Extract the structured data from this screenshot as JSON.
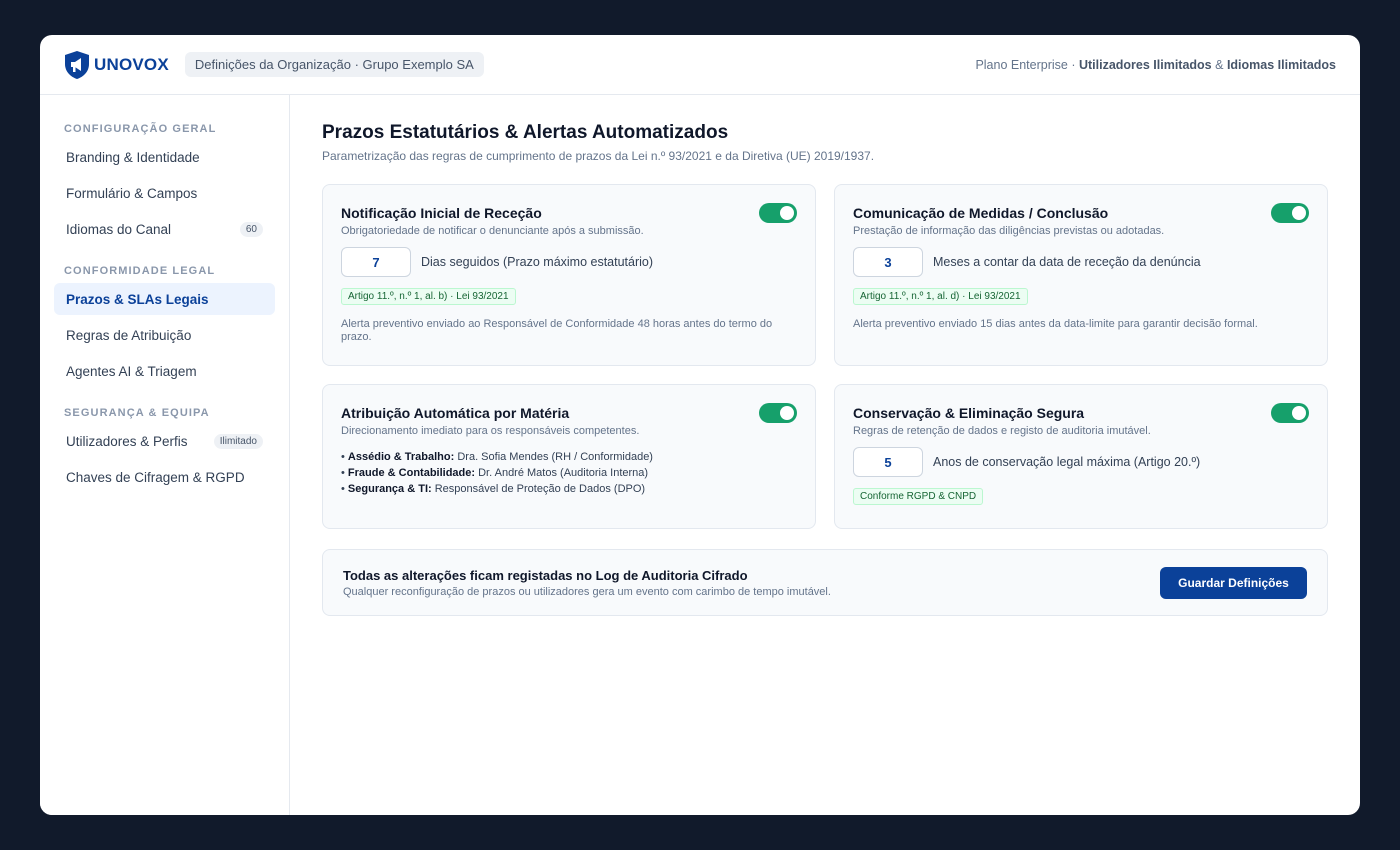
{
  "header": {
    "brand": "UNOVOX",
    "org_context": "Definições da Organização · Grupo Exemplo SA",
    "plan_prefix": "Plano Enterprise · ",
    "plan_users": "Utilizadores Ilimitados",
    "plan_joiner": " & ",
    "plan_languages": "Idiomas Ilimitados"
  },
  "sidebar": {
    "sections": [
      {
        "heading": "CONFIGURAÇÃO GERAL",
        "items": [
          {
            "label": "Branding & Identidade"
          },
          {
            "label": "Formulário & Campos"
          },
          {
            "label": "Idiomas do Canal",
            "badge": "60"
          }
        ]
      },
      {
        "heading": "CONFORMIDADE LEGAL",
        "items": [
          {
            "label": "Prazos & SLAs Legais",
            "active": true
          },
          {
            "label": "Regras de Atribuição"
          },
          {
            "label": "Agentes AI & Triagem"
          }
        ]
      },
      {
        "heading": "SEGURANÇA & EQUIPA",
        "items": [
          {
            "label": "Utilizadores & Perfis",
            "badge": "Ilimitado"
          },
          {
            "label": "Chaves de Cifragem & RGPD"
          }
        ]
      }
    ]
  },
  "main": {
    "title": "Prazos Estatutários & Alertas Automatizados",
    "subtitle": "Parametrização das regras de cumprimento de prazos da Lei n.º 93/2021 e da Diretiva (UE) 2019/1937.",
    "cards": {
      "reception": {
        "title": "Notificação Inicial de Receção",
        "desc": "Obrigatoriedade de notificar o denunciante após a submissão.",
        "enabled": true,
        "value": "7",
        "value_label": "Dias seguidos (Prazo máximo estatutário)",
        "law": "Artigo 11.º, n.º 1, al. b) · Lei 93/2021",
        "note": "Alerta preventivo enviado ao Responsável de Conformidade 48 horas antes do termo do prazo."
      },
      "conclusion": {
        "title": "Comunicação de Medidas / Conclusão",
        "desc": "Prestação de informação das diligências previstas ou adotadas.",
        "enabled": true,
        "value": "3",
        "value_label": "Meses a contar da data de receção da denúncia",
        "law": "Artigo 11.º, n.º 1, al. d) · Lei 93/2021",
        "note": "Alerta preventivo enviado 15 dias antes da data-limite para garantir decisão formal."
      },
      "assignment": {
        "title": "Atribuição Automática por Matéria",
        "desc": "Direcionamento imediato para os responsáveis competentes.",
        "enabled": true,
        "rules": [
          {
            "topic": "Assédio & Trabalho:",
            "owner": "Dra. Sofia Mendes (RH / Conformidade)"
          },
          {
            "topic": "Fraude & Contabilidade:",
            "owner": "Dr. André Matos (Auditoria Interna)"
          },
          {
            "topic": "Segurança & TI:",
            "owner": "Responsável de Proteção de Dados (DPO)"
          }
        ]
      },
      "retention": {
        "title": "Conservação & Eliminação Segura",
        "desc": "Regras de retenção de dados e registo de auditoria imutável.",
        "enabled": true,
        "value": "5",
        "value_label": "Anos de conservação legal máxima (Artigo 20.º)",
        "law": "Conforme RGPD & CNPD"
      }
    },
    "footer": {
      "title": "Todas as alterações ficam registadas no Log de Auditoria Cifrado",
      "subtitle": "Qualquer reconfiguração de prazos ou utilizadores gera um evento com carimbo de tempo imutável.",
      "save_label": "Guardar Definições"
    }
  },
  "colors": {
    "accent": "#0b4199",
    "toggle_on": "#16a06b",
    "backdrop": "#111a2b"
  }
}
